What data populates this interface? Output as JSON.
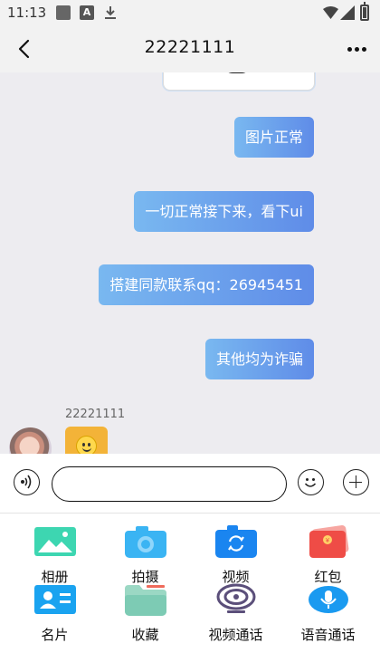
{
  "status_bar": {
    "time": "11:13",
    "icons": [
      "square-icon",
      "a-icon",
      "download-icon",
      "wifi-icon",
      "signal-icon",
      "battery-icon"
    ]
  },
  "header": {
    "title": "22221111",
    "back_icon": "chevron-left-icon",
    "more_icon": "more-horizontal-icon"
  },
  "messages": [
    {
      "type": "image",
      "direction": "outgoing"
    },
    {
      "type": "text",
      "direction": "outgoing",
      "text": "图片正常"
    },
    {
      "type": "text",
      "direction": "outgoing",
      "text": "一切正常接下来，看下ui"
    },
    {
      "type": "text",
      "direction": "outgoing",
      "text": "搭建同款联系qq：26945451"
    },
    {
      "type": "text",
      "direction": "outgoing",
      "text": "其他均为诈骗"
    }
  ],
  "incoming": {
    "sender": "22221111",
    "emoji": "smiley-emoji"
  },
  "input_bar": {
    "placeholder": "",
    "value": "",
    "voice_icon": "voice-icon",
    "emoji_icon": "emoji-icon",
    "plus_icon": "plus-icon"
  },
  "panel": {
    "items": [
      {
        "label": "相册",
        "icon": "album-icon",
        "color": "#3dd6b1"
      },
      {
        "label": "拍摄",
        "icon": "camera-icon",
        "color": "#3ab4f3"
      },
      {
        "label": "视频",
        "icon": "video-icon",
        "color": "#1a85f0"
      },
      {
        "label": "红包",
        "icon": "red-packet-icon",
        "color": "#ef4c46"
      },
      {
        "label": "名片",
        "icon": "contact-card-icon",
        "color": "#1aa3f0"
      },
      {
        "label": "收藏",
        "icon": "favorites-folder-icon",
        "color": "#7dcbb4"
      },
      {
        "label": "视频通话",
        "icon": "video-call-icon",
        "color": "#5b4f7a"
      },
      {
        "label": "语音通话",
        "icon": "voice-call-icon",
        "color": "#1a9af0"
      }
    ]
  },
  "colors": {
    "bubble_start": "#79b8f0",
    "bubble_end": "#5f8ce8",
    "chat_background": "#edecf0",
    "header_background": "#f2f2f2"
  }
}
